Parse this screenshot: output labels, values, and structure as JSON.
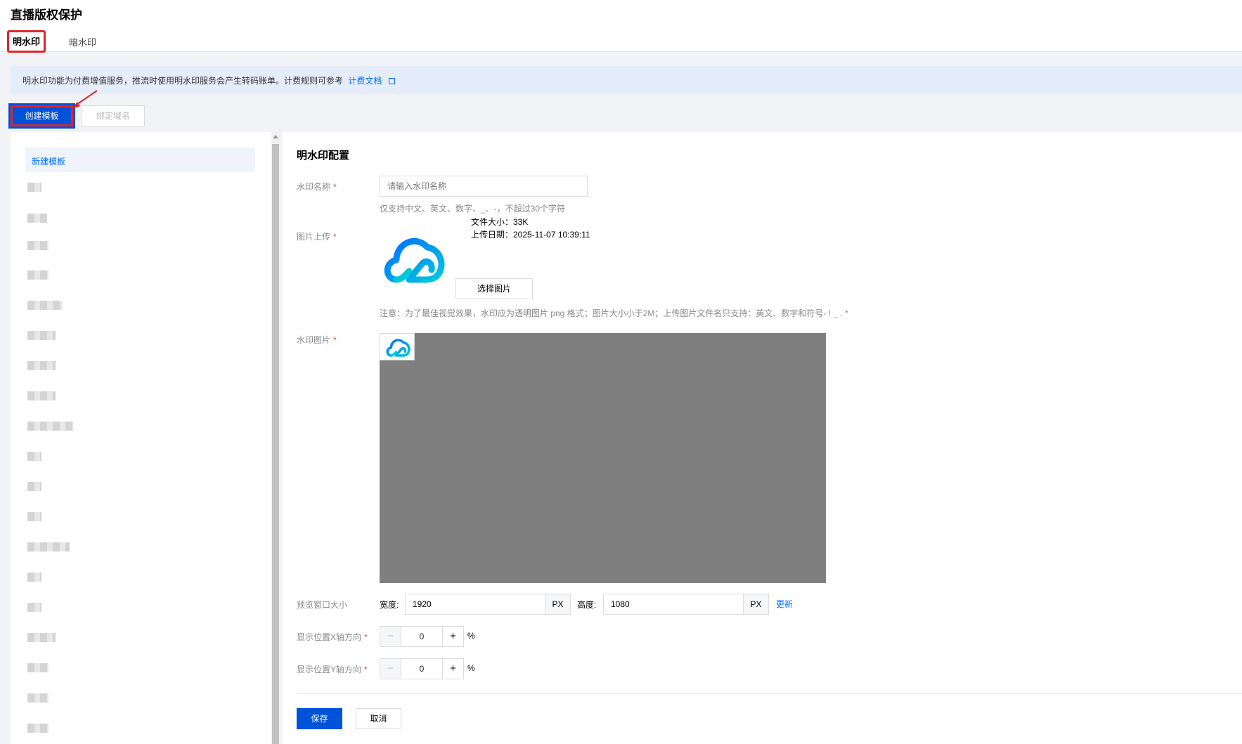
{
  "page": {
    "title": "直播版权保护"
  },
  "tabs": [
    {
      "label": "明水印",
      "active": true
    },
    {
      "label": "暗水印",
      "active": false
    }
  ],
  "notice": {
    "text": "明水印功能为付费增值服务，推流时使用明水印服务会产生转码账单。计费规则可参考",
    "link_label": "计费文档"
  },
  "toolbar": {
    "create_label": "创建模板",
    "bind_label": "绑定域名"
  },
  "template_list": {
    "new_item_label": "新建模板"
  },
  "config": {
    "title": "明水印配置",
    "name_label": "水印名称",
    "name_placeholder": "请输入水印名称",
    "name_hint": "仅支持中文、英文、数字、_、-，不超过30个字符",
    "upload_label": "图片上传",
    "file_size": "文件大小：33K",
    "upload_date": "上传日期：2025-11-07 10:39:11",
    "choose_label": "选择图片",
    "upload_hint": "注意：为了最佳视觉效果，水印应为透明图片 png 格式；图片大小小于2M；上传图片文件名只支持：英文、数字和符号- ! _ . *",
    "watermark_label": "水印图片",
    "preview_label": "预览窗口大小",
    "width_label": "宽度:",
    "width_value": "1920",
    "height_label": "高度:",
    "height_value": "1080",
    "unit": "PX",
    "update_label": "更新",
    "x_label": "显示位置X轴方向",
    "x_value": "0",
    "y_label": "显示位置Y轴方向",
    "y_value": "0",
    "percent": "%",
    "minus": "−",
    "plus": "+",
    "save_label": "保存",
    "cancel_label": "取消"
  },
  "colors": {
    "primary": "#0052d9",
    "highlight": "#e0242b",
    "link": "#006eff"
  }
}
